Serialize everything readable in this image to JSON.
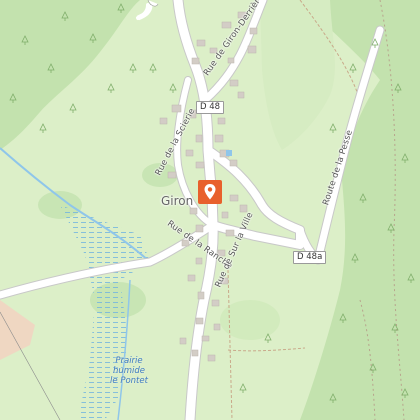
{
  "map": {
    "place_label": "Giron",
    "road_shields": [
      "D 48",
      "D 48a"
    ],
    "street_labels": [
      "Rue de Giron-Derrière",
      "Rue de la Scierie",
      "Rue de la Ranche",
      "Rue de Sur la Ville",
      "Route de la Pesse"
    ],
    "area_label": {
      "line1": "Prairie",
      "line2": "humide",
      "line3": "le Pontet"
    },
    "marker_color": "#e8602c",
    "colors": {
      "meadow": "#dcefc8",
      "forest": "#bddda8",
      "road": "#ffffff",
      "building": "#d3cdc6",
      "water": "#8fc6ea"
    }
  }
}
